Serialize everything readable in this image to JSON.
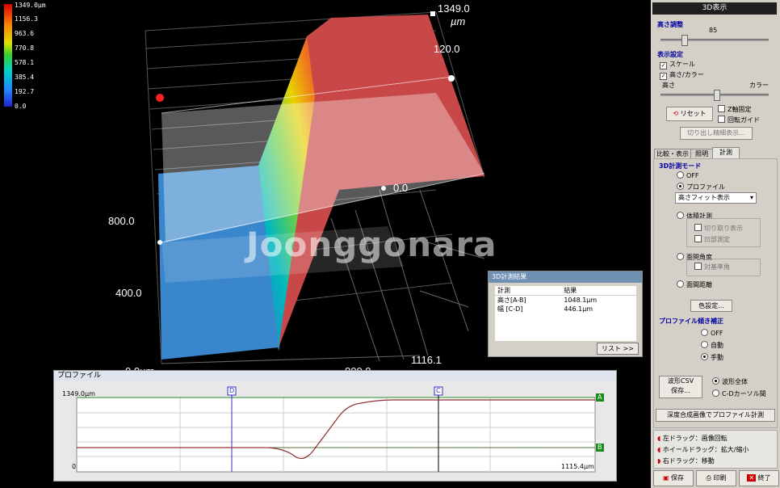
{
  "colorbar": {
    "labels": [
      "1349.0µm",
      "1156.3",
      "963.6",
      "770.8",
      "578.1",
      "385.4",
      "192.7",
      "0.0"
    ]
  },
  "axes": {
    "top_max": "1349.0",
    "top_unit": "µm",
    "right_val": "120.0",
    "right_zero": "0.0",
    "left_800": "800.0",
    "left_400": "400.0",
    "bottom_right": "1116.1",
    "bottom_left": "0.0µm",
    "bottom_mid": "800.0"
  },
  "watermark": "Joonggonara",
  "result_dialog": {
    "title": "3D計測結果",
    "col_measure": "計測",
    "col_result": "結果",
    "rows": [
      {
        "name": "高さ[A-B]",
        "value": "1048.1µm"
      },
      {
        "name": "幅 [C-D]",
        "value": "446.1µm"
      }
    ],
    "list_button": "リスト >>"
  },
  "profile": {
    "title": "プロファイル",
    "y_max": "1349.0µm",
    "x_min": "0",
    "x_max": "1115.4µm",
    "marker_d": "D",
    "marker_c": "C",
    "marker_a": "A",
    "marker_b": "B"
  },
  "panel": {
    "title": "3D表示",
    "height_adjust": "高さ調整",
    "height_value": "85",
    "display_settings": "表示設定",
    "scale_label": "スケール",
    "height_color_label": "高さ/カラー",
    "height_lbl": "高さ",
    "color_lbl": "カラー",
    "reset_button": "リセット",
    "z_fix": "Z軸固定",
    "rotate_guide": "回転ガイド",
    "crop_button": "切り出し精細表示...",
    "tabs": [
      "比較・表示",
      "照明",
      "計測"
    ],
    "mode_title": "3D計測モード",
    "mode_off": "OFF",
    "mode_profile": "プロファイル",
    "profile_select": "高さフィット表示",
    "mode_volume": "体積計測",
    "volume_opt1": "切り取り表示",
    "volume_opt2": "凹部測定",
    "mode_angle": "面間角度",
    "angle_opt": "対基準角",
    "mode_distance": "面間距離",
    "color_setting_button": "色設定...",
    "tilt_title": "プロファイル傾き補正",
    "tilt_off": "OFF",
    "tilt_auto": "自動",
    "tilt_manual": "手動",
    "csv_button": "波形CSV\n保存...",
    "wave_all": "波形全体",
    "cd_cursor": "C-Dカーソル間",
    "depth_button": "深度合成画像でプロファイル計測",
    "help_left": "左ドラッグ：画像回転",
    "help_wheel": "ホイールドラッグ：拡大/縮小",
    "help_right": "右ドラッグ：移動",
    "save_button": "保存",
    "print_button": "印刷",
    "exit_button": "終了"
  }
}
